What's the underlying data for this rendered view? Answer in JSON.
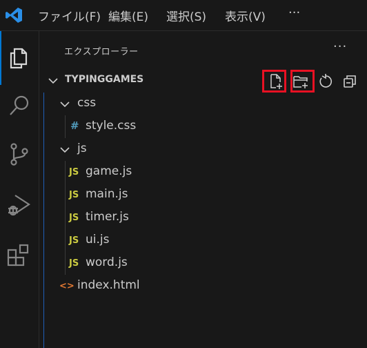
{
  "menu": {
    "items": [
      "ファイル(F)",
      "編集(E)",
      "選択(S)",
      "表示(V)"
    ],
    "more": "···"
  },
  "colors": {
    "accent": "#0078d4",
    "highlight": "#e81123",
    "js_icon": "#cbcb41",
    "css_icon": "#519aba",
    "html_icon": "#e37933"
  },
  "activity_bar": {
    "icons": [
      "explorer-icon",
      "search-icon",
      "source-control-icon",
      "run-debug-icon",
      "extensions-icon"
    ]
  },
  "explorer": {
    "title": "エクスプローラー",
    "more": "···",
    "folder": "TYPINGGAMES",
    "toolbar_icons": [
      "new-file-icon",
      "new-folder-icon",
      "refresh-icon",
      "collapse-all-icon"
    ]
  },
  "tree": {
    "css_folder": "css",
    "style_css": "style.css",
    "js_folder": "js",
    "game_js": "game.js",
    "main_js": "main.js",
    "timer_js": "timer.js",
    "ui_js": "ui.js",
    "word_js": "word.js",
    "index_html": "index.html",
    "js_badge": "JS",
    "css_badge": "#",
    "html_badge": "<>"
  }
}
